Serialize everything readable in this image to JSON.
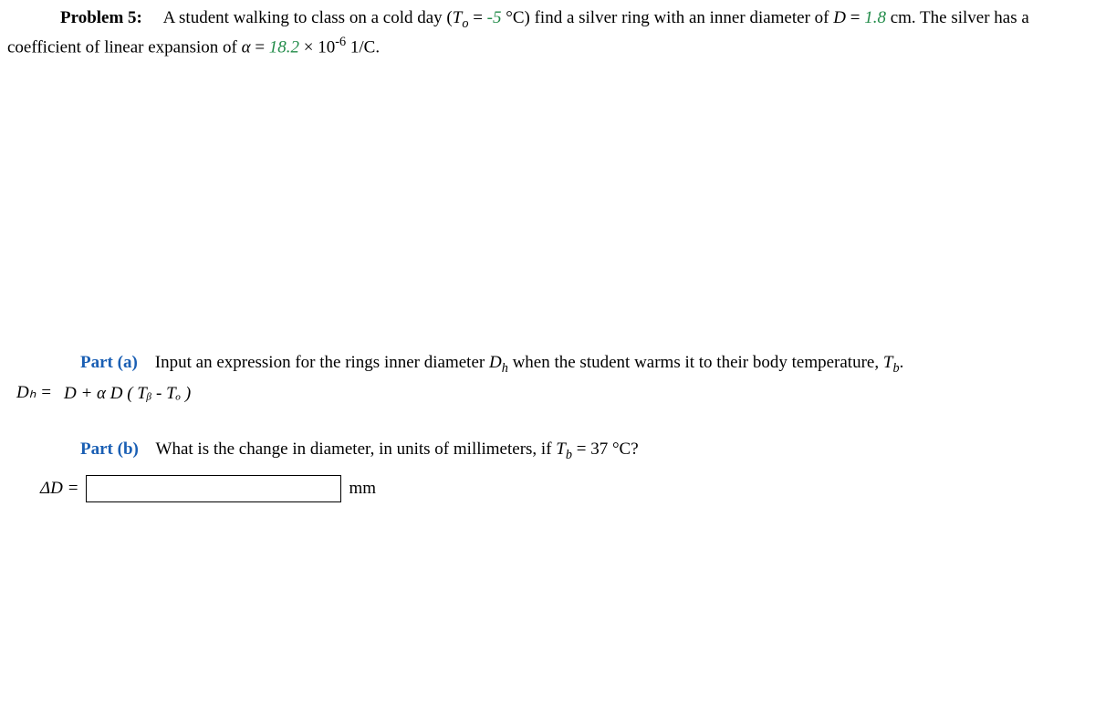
{
  "problem": {
    "label": "Problem 5:",
    "text1a": "A student walking to class on a cold day (",
    "To_sym": "T",
    "To_sub": "o",
    "text1b": " = ",
    "To_val": "-5",
    "To_unit": " °C) find a silver ring with an inner diameter of ",
    "D_sym": "D",
    "eq": " = ",
    "D_val": "1.8",
    "D_unit": " cm. The silver has a",
    "text2a": "coefficient of linear expansion of ",
    "alpha_sym": "α",
    "text2b": " = ",
    "alpha_val": "18.2",
    "text2c": " × 10",
    "alpha_exp": "-6",
    "text2d": " 1/C."
  },
  "partA": {
    "label": "Part (a)",
    "prompt_a": "Input an expression for the rings inner diameter ",
    "Dh_sym": "D",
    "Dh_sub": "h",
    "prompt_b": " when the student warms it to their body temperature, ",
    "Tb_sym": "T",
    "Tb_sub": "b",
    "prompt_c": ".",
    "expr_lhs": "Dₕ = ",
    "expr_rhs": "D + α D ( Tᵦ - Tₒ )"
  },
  "partB": {
    "label": "Part (b)",
    "prompt_a": "What is the change in diameter, in units of millimeters, if ",
    "Tb_sym": "T",
    "Tb_sub": "b",
    "prompt_b": " = 37 °C?",
    "answer_label": "ΔD = ",
    "answer_value": "",
    "answer_placeholder": "",
    "unit": "mm"
  }
}
